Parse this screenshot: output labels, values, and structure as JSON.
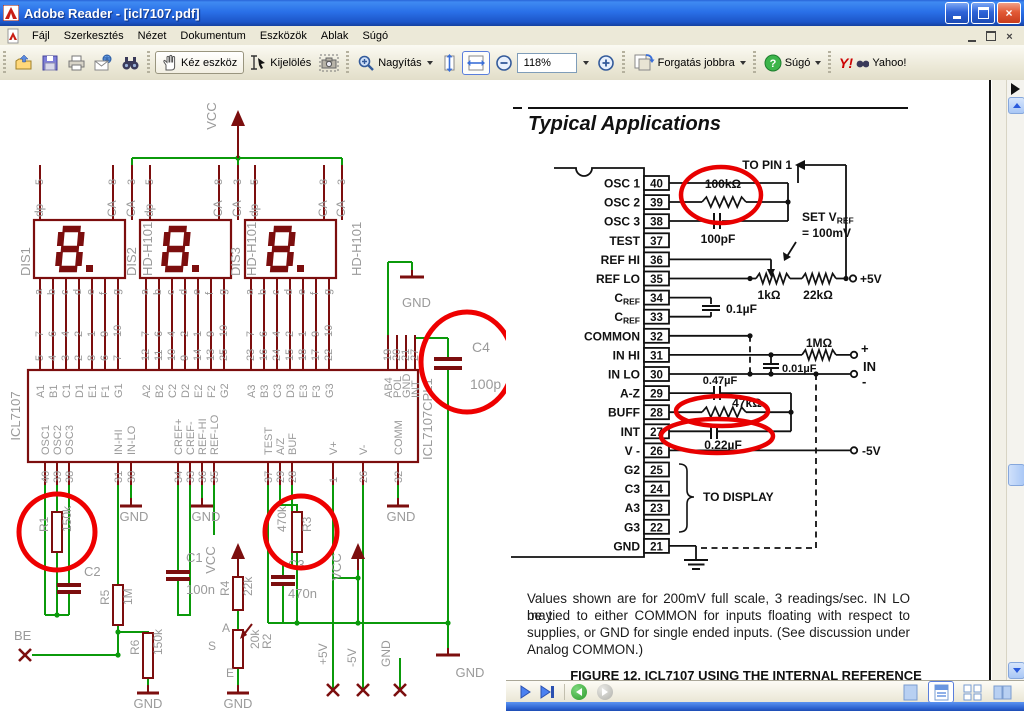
{
  "titlebar": {
    "title": "Adobe Reader - [icl7107.pdf]"
  },
  "menubar": {
    "items": [
      "Fájl",
      "Szerkesztés",
      "Nézet",
      "Dokumentum",
      "Eszközök",
      "Ablak",
      "Súgó"
    ]
  },
  "toolbar": {
    "hand": "Kéz eszköz",
    "select": "Kijelölés",
    "zoom": "Nagyítás",
    "zoom_value": "118%",
    "rotate": "Forgatás jobbra",
    "help": "Súgó",
    "yahoo": "Yahoo!"
  },
  "page": {
    "heading": "Typical Applications",
    "pins": [
      {
        "label": "OSC 1",
        "num": "40"
      },
      {
        "label": "OSC 2",
        "num": "39"
      },
      {
        "label": "OSC 3",
        "num": "38"
      },
      {
        "label": "TEST",
        "num": "37"
      },
      {
        "label": "REF HI",
        "num": "36"
      },
      {
        "label": "REF LO",
        "num": "35"
      },
      {
        "label": "CREF",
        "num": "34"
      },
      {
        "label": "CREF",
        "num": "33"
      },
      {
        "label": "COMMON",
        "num": "32"
      },
      {
        "label": "IN HI",
        "num": "31"
      },
      {
        "label": "IN LO",
        "num": "30"
      },
      {
        "label": "A-Z",
        "num": "29"
      },
      {
        "label": "BUFF",
        "num": "28"
      },
      {
        "label": "INT",
        "num": "27"
      },
      {
        "label": "V -",
        "num": "26"
      },
      {
        "label": "G2",
        "num": "25"
      },
      {
        "label": "C3",
        "num": "24"
      },
      {
        "label": "A3",
        "num": "23"
      },
      {
        "label": "G3",
        "num": "22"
      },
      {
        "label": "GND",
        "num": "21"
      }
    ],
    "labels": {
      "to_pin_1": "TO PIN 1",
      "r_osc": "100kΩ",
      "c_osc": "100pF",
      "set_vref_a": "SET V",
      "set_vref_sub": "REF",
      "set_vref_b": "= 100mV",
      "r_pot": "1kΩ",
      "r_div": "22kΩ",
      "plus5": "+5V",
      "c_ref": "0.1µF",
      "r_in": "1MΩ",
      "in_plus": "+",
      "in_label": "IN",
      "in_minus": "-",
      "c_in": "0.01µF",
      "c_az": "0.47µF",
      "r_buf": "47kΩ",
      "c_int": "0.22µF",
      "minus5": "-5V",
      "to_display": "TO DISPLAY"
    },
    "body_lines": [
      "Values shown are for 200mV full scale, 3 readings/sec. IN LO may",
      "be tied to either COMMON for inputs floating with respect to",
      "supplies, or GND for single ended inputs. (See discussion under",
      "Analog COMMON.)"
    ],
    "caption": "FIGURE 12. ICL7107 USING THE INTERNAL REFERENCE"
  },
  "schematic": {
    "display_labels": [
      "DIS1",
      "DIS2",
      "HD-H101",
      "DIS3",
      "HD-H101",
      "HD-H101"
    ],
    "digit_value": "8.",
    "disp_pin_labels": [
      "dp",
      "CA",
      "CA"
    ],
    "disp_pin_nums": [
      "5",
      "8",
      "3"
    ],
    "seg_labels": [
      "a",
      "b",
      "c",
      "d",
      "e",
      "f",
      "g"
    ],
    "disp_seg_nums": [
      "7",
      "6",
      "4",
      "2",
      "1",
      "9",
      "10"
    ],
    "ic_seg_nums": [
      "5",
      "4",
      "3",
      "2",
      "8",
      "6",
      "7",
      "12",
      "11",
      "10",
      "9",
      "14",
      "13",
      "25",
      "23",
      "16",
      "24",
      "15",
      "18",
      "17",
      "22"
    ],
    "extra_pin_nums": [
      "19",
      "20",
      "21",
      "27"
    ],
    "ic": {
      "name": "ICL7107",
      "part": "ICL7107CPL1",
      "top_pins": [
        "A1",
        "B1",
        "C1",
        "D1",
        "E1",
        "F1",
        "G1",
        "A2",
        "B2",
        "C2",
        "D2",
        "E2",
        "F2",
        "G2",
        "A3",
        "B3",
        "C3",
        "D3",
        "E3",
        "F3",
        "G3",
        "AB4",
        "POL",
        "GND",
        "INT"
      ],
      "bottom_pins": [
        {
          "label": "OSC1",
          "num": "40"
        },
        {
          "label": "OSC2",
          "num": "39"
        },
        {
          "label": "OSC3",
          "num": "38"
        },
        {
          "label": "IN-HI",
          "num": "31"
        },
        {
          "label": "IN-LO",
          "num": "30"
        },
        {
          "label": "CREF+",
          "num": "34"
        },
        {
          "label": "CREF-",
          "num": "33"
        },
        {
          "label": "REF-HI",
          "num": "36"
        },
        {
          "label": "REF-LO",
          "num": "35"
        },
        {
          "label": "TEST",
          "num": "37"
        },
        {
          "label": "A/Z",
          "num": "29"
        },
        {
          "label": "BUF",
          "num": "28"
        },
        {
          "label": "V+",
          "num": "1"
        },
        {
          "label": "V-",
          "num": "26"
        },
        {
          "label": "COMM",
          "num": "32"
        }
      ]
    },
    "labels": {
      "vcc": "VCC",
      "gnd": "GND",
      "be": "BE",
      "r1": "R1",
      "r1v": "150k",
      "r2": "R2",
      "r2v": "20k",
      "r3": "R3",
      "r3v": "470k",
      "r4": "R4",
      "r4v": "22k",
      "r5": "R5",
      "r5v": "1M",
      "r6": "R6",
      "r6v": "150k",
      "c1": "C1",
      "c1v": "100n",
      "c2": "C2",
      "c3": "C3",
      "c3v": "470n",
      "c4": "C4",
      "c4v": "100p",
      "pot_s": "S",
      "pot_a": "A",
      "pot_e": "E",
      "p5": "+5V",
      "m5": "-5V"
    },
    "colors": {
      "wire_green": "#0b9a0b",
      "symbol_red": "#7c0e0e",
      "label_gray": "#9a9a9a",
      "annotation_red": "#ee0000"
    }
  }
}
